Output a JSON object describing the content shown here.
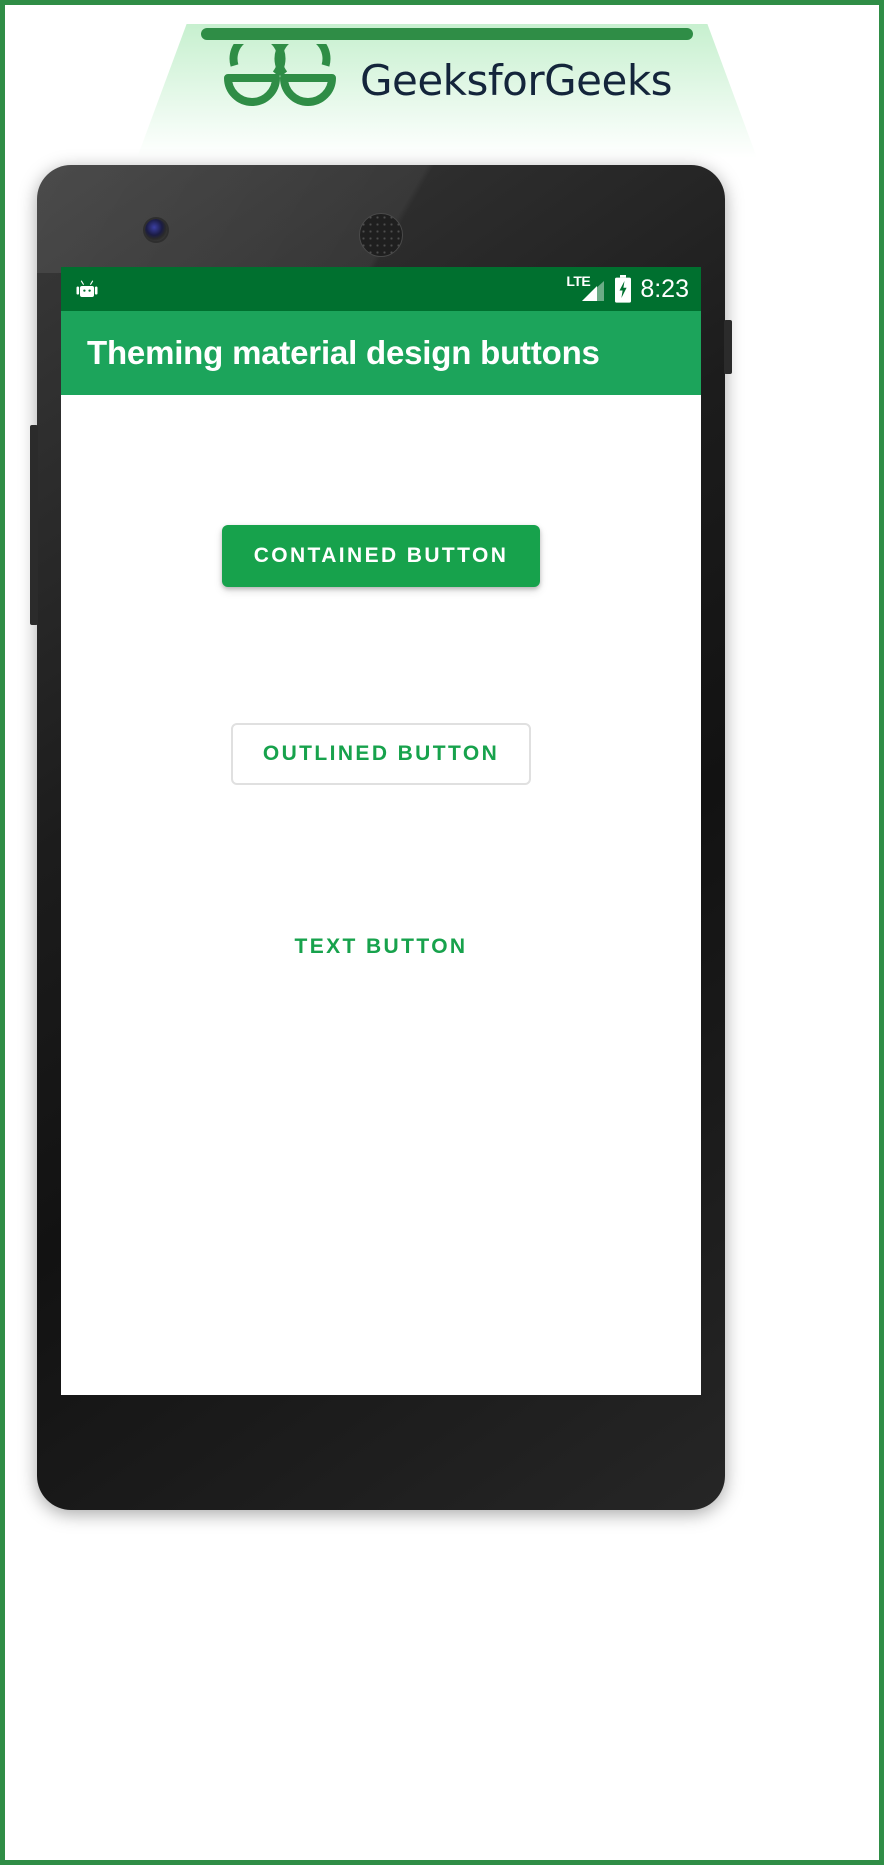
{
  "branding": {
    "wordmark": "GeeksforGeeks",
    "logo_icon": "geeksforgeeks-logo-icon",
    "accent_color": "#2F8D46",
    "gradient_top": "#c7f0cf",
    "wordmark_color": "#14253b"
  },
  "device": {
    "type": "android-phone-mockup",
    "camera_icon": "front-camera-icon",
    "speaker_icon": "earpiece-speaker-icon"
  },
  "statusbar": {
    "background_color": "#00702F",
    "app_icon": "android-robot-icon",
    "network_label": "LTE",
    "signal_icon": "signal-bars-icon",
    "battery_icon": "battery-charging-icon",
    "time": "8:23"
  },
  "appbar": {
    "title": "Theming material design buttons",
    "background_color": "#1CA45B",
    "text_color": "#ffffff"
  },
  "main": {
    "background_color": "#ffffff",
    "buttons": [
      {
        "id": "contained",
        "label": "CONTAINED BUTTON",
        "style": "contained",
        "fill_color": "#17A24C",
        "text_color": "#ffffff"
      },
      {
        "id": "outlined",
        "label": "OUTLINED BUTTON",
        "style": "outlined",
        "fill_color": "#ffffff",
        "text_color": "#17A24C",
        "border_color": "#e0e0e0"
      },
      {
        "id": "text",
        "label": "TEXT BUTTON",
        "style": "text",
        "fill_color": "transparent",
        "text_color": "#17A24C"
      }
    ]
  },
  "navbar": {
    "background_color": "#000000",
    "items": [
      {
        "id": "back",
        "icon": "back-triangle-icon"
      },
      {
        "id": "home",
        "icon": "home-circle-icon"
      },
      {
        "id": "recents",
        "icon": "recents-square-icon"
      }
    ]
  }
}
